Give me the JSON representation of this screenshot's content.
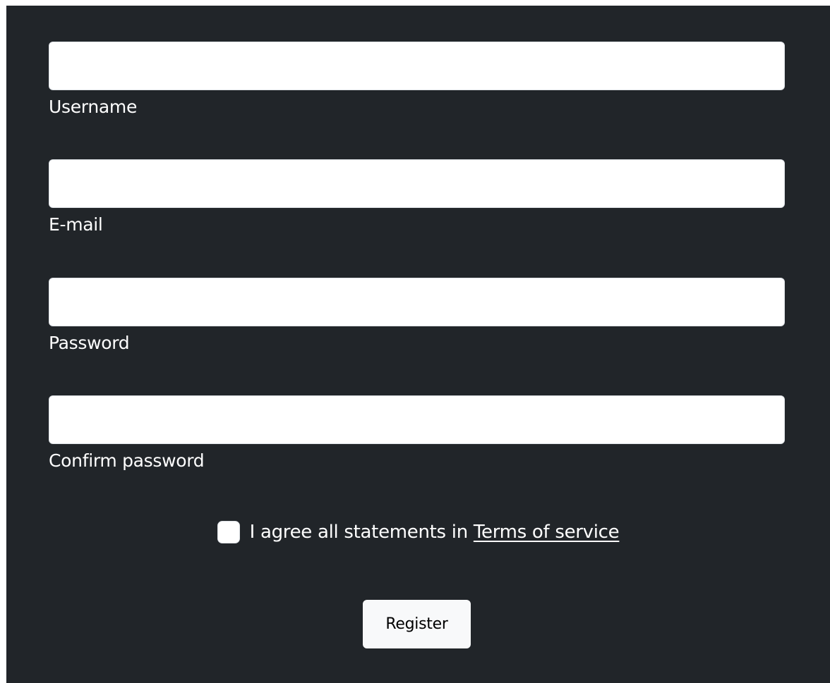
{
  "form": {
    "fields": [
      {
        "label": "Username",
        "value": "",
        "type": "text"
      },
      {
        "label": "E-mail",
        "value": "",
        "type": "email"
      },
      {
        "label": "Password",
        "value": "",
        "type": "password"
      },
      {
        "label": "Confirm password",
        "value": "",
        "type": "password"
      }
    ],
    "agreement": {
      "checked": false,
      "text": "I agree all statements in",
      "link_text": "Terms of service"
    },
    "submit_label": "Register"
  },
  "colors": {
    "panel_background": "#212529",
    "input_background": "#ffffff",
    "button_background": "#f8f9fa",
    "text": "#ffffff"
  }
}
